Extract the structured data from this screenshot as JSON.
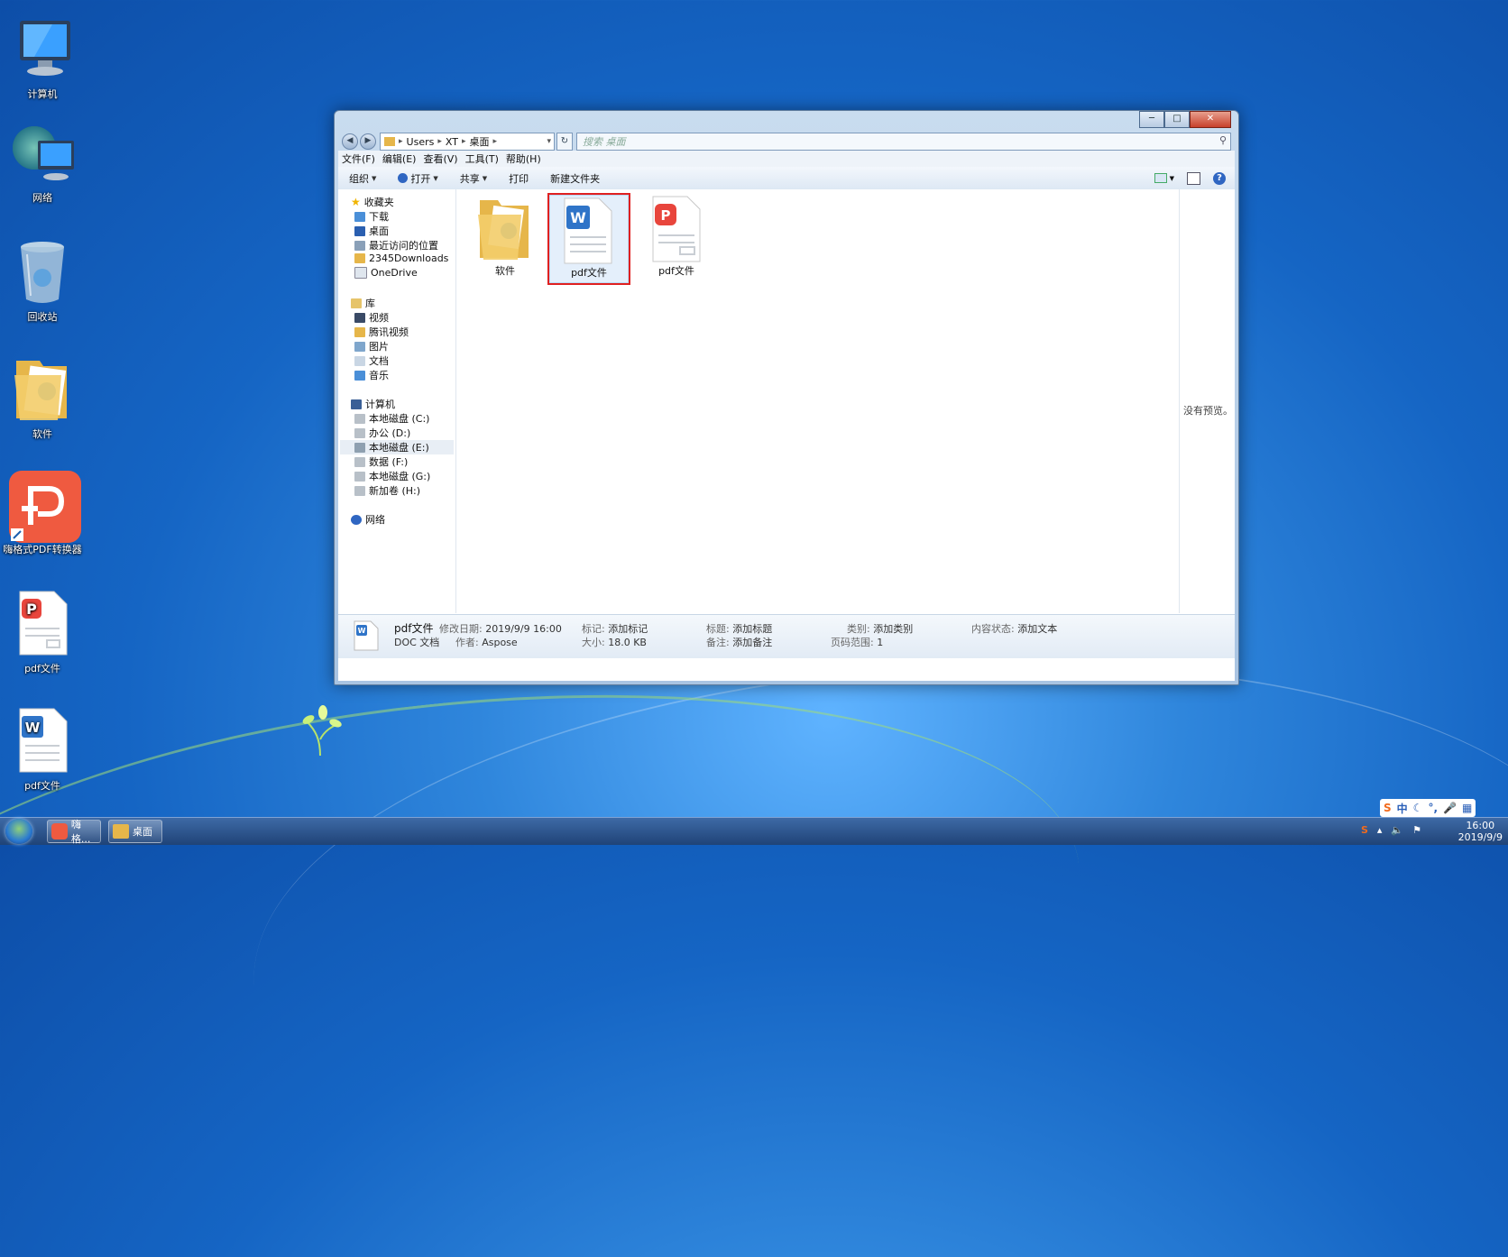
{
  "desktop": {
    "icons": [
      {
        "label": "计算机"
      },
      {
        "label": "网络"
      },
      {
        "label": "回收站"
      },
      {
        "label": "软件"
      },
      {
        "label": "嗨格式PDF转换器"
      },
      {
        "label": "pdf文件"
      },
      {
        "label": "pdf文件"
      }
    ]
  },
  "window": {
    "breadcrumb": [
      "Users",
      "XT",
      "桌面"
    ],
    "search_placeholder": "搜索 桌面",
    "menu": [
      "文件(F)",
      "编辑(E)",
      "查看(V)",
      "工具(T)",
      "帮助(H)"
    ],
    "toolbar": {
      "organize": "组织",
      "open": "打开",
      "share": "共享",
      "print": "打印",
      "new_folder": "新建文件夹"
    },
    "nav": {
      "favorites": "收藏夹",
      "fav_items": [
        "下载",
        "桌面",
        "最近访问的位置",
        "2345Downloads",
        "OneDrive"
      ],
      "libraries": "库",
      "lib_items": [
        "视频",
        "腾讯视频",
        "图片",
        "文档",
        "音乐"
      ],
      "computer": "计算机",
      "drives": [
        "本地磁盘 (C:)",
        "办公 (D:)",
        "本地磁盘 (E:)",
        "数据 (F:)",
        "本地磁盘 (G:)",
        "新加卷 (H:)"
      ],
      "network": "网络"
    },
    "files": [
      {
        "name": "软件",
        "type": "folder"
      },
      {
        "name": "pdf文件",
        "type": "word",
        "selected": true
      },
      {
        "name": "pdf文件",
        "type": "pdf"
      }
    ],
    "preview_text": "没有预览。",
    "details": {
      "name": "pdf文件",
      "type": "DOC 文档",
      "modified_label": "修改日期:",
      "modified": "2019/9/9 16:00",
      "author_label": "作者:",
      "author": "Aspose",
      "tags_label": "标记:",
      "tags": "添加标记",
      "size_label": "大小:",
      "size": "18.0 KB",
      "title_label": "标题:",
      "title": "添加标题",
      "comments_label": "备注:",
      "comments": "添加备注",
      "category_label": "类别:",
      "category": "添加类别",
      "pages_label": "页码范围:",
      "pages": "1",
      "status_label": "内容状态:",
      "status": "添加文本"
    }
  },
  "taskbar": {
    "buttons": [
      "嗨格...",
      "桌面"
    ],
    "time": "16:00",
    "date": "2019/9/9",
    "ime": "中"
  },
  "colors": {
    "accent": "#2f86dc",
    "selection_border": "#e02020",
    "pdf_red": "#e8453c",
    "word_blue": "#2f74c8"
  }
}
